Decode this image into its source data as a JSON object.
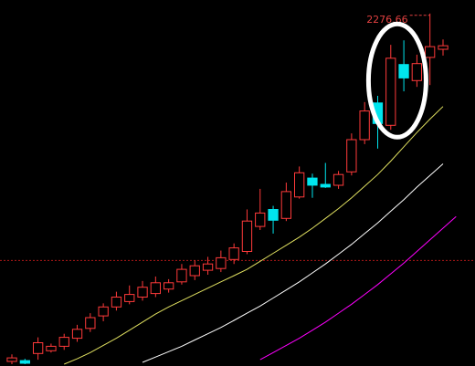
{
  "chart_data": {
    "type": "candlestick",
    "title": "",
    "xlabel": "",
    "ylabel": "",
    "ylim": [
      0,
      401
    ],
    "max_price_label": "2276.66",
    "reference_line": 116,
    "grid": false,
    "colors": {
      "background": "#000000",
      "up": "#ff3a3a",
      "down": "#00e5ee",
      "reference_line": "#b01818",
      "highlight_ellipse": "#ffffff"
    },
    "candles": [
      {
        "o": 3,
        "c": 7,
        "h": 11,
        "l": 0
      },
      {
        "o": 4,
        "c": 1,
        "h": 6,
        "l": 0
      },
      {
        "o": 12,
        "c": 24,
        "h": 30,
        "l": 5
      },
      {
        "o": 15,
        "c": 20,
        "h": 23,
        "l": 13
      },
      {
        "o": 20,
        "c": 30,
        "h": 34,
        "l": 16
      },
      {
        "o": 29,
        "c": 39,
        "h": 44,
        "l": 25
      },
      {
        "o": 40,
        "c": 52,
        "h": 57,
        "l": 36
      },
      {
        "o": 54,
        "c": 64,
        "h": 68,
        "l": 48
      },
      {
        "o": 64,
        "c": 75,
        "h": 81,
        "l": 60
      },
      {
        "o": 70,
        "c": 78,
        "h": 88,
        "l": 67
      },
      {
        "o": 75,
        "c": 86,
        "h": 93,
        "l": 71
      },
      {
        "o": 79,
        "c": 91,
        "h": 98,
        "l": 75
      },
      {
        "o": 84,
        "c": 91,
        "h": 95,
        "l": 80
      },
      {
        "o": 92,
        "c": 106,
        "h": 112,
        "l": 89
      },
      {
        "o": 99,
        "c": 110,
        "h": 116,
        "l": 94
      },
      {
        "o": 105,
        "c": 112,
        "h": 120,
        "l": 100
      },
      {
        "o": 107,
        "c": 119,
        "h": 127,
        "l": 103
      },
      {
        "o": 117,
        "c": 130,
        "h": 135,
        "l": 112
      },
      {
        "o": 126,
        "c": 160,
        "h": 173,
        "l": 123
      },
      {
        "o": 154,
        "c": 169,
        "h": 196,
        "l": 150
      },
      {
        "o": 173,
        "c": 161,
        "h": 177,
        "l": 146
      },
      {
        "o": 163,
        "c": 193,
        "h": 203,
        "l": 160
      },
      {
        "o": 187,
        "c": 214,
        "h": 221,
        "l": 185
      },
      {
        "o": 208,
        "c": 200,
        "h": 213,
        "l": 186
      },
      {
        "o": 201,
        "c": 198,
        "h": 225,
        "l": 197
      },
      {
        "o": 200,
        "c": 212,
        "h": 216,
        "l": 196
      },
      {
        "o": 215,
        "c": 251,
        "h": 258,
        "l": 211
      },
      {
        "o": 251,
        "c": 283,
        "h": 293,
        "l": 246
      },
      {
        "o": 292,
        "c": 269,
        "h": 300,
        "l": 241
      },
      {
        "o": 267,
        "c": 342,
        "h": 357,
        "l": 262
      },
      {
        "o": 335,
        "c": 320,
        "h": 362,
        "l": 305
      },
      {
        "o": 317,
        "c": 336,
        "h": 346,
        "l": 310
      },
      {
        "o": 343,
        "c": 355,
        "h": 392,
        "l": 312
      },
      {
        "o": 352,
        "c": 356,
        "h": 363,
        "l": 345
      }
    ],
    "moving_averages": [
      {
        "color": "#e0e060",
        "values": [
          null,
          null,
          null,
          null,
          0,
          6,
          13,
          21,
          29,
          38,
          47,
          56,
          64,
          71,
          78,
          85,
          92,
          99,
          106,
          115,
          124,
          133,
          142,
          152,
          163,
          174,
          186,
          199,
          212,
          227,
          243,
          259,
          274,
          288
        ]
      },
      {
        "color": "#ffffff",
        "values": [
          null,
          null,
          null,
          null,
          null,
          null,
          null,
          null,
          null,
          null,
          2,
          8,
          14,
          20,
          27,
          34,
          41,
          49,
          57,
          65,
          74,
          83,
          92,
          102,
          112,
          123,
          134,
          146,
          158,
          171,
          184,
          198,
          211,
          224
        ]
      },
      {
        "color": "#ff00ff",
        "values": [
          null,
          null,
          null,
          null,
          null,
          null,
          null,
          null,
          null,
          null,
          null,
          null,
          null,
          null,
          null,
          null,
          null,
          null,
          null,
          5,
          13,
          21,
          29,
          38,
          47,
          57,
          67,
          78,
          89,
          101,
          113,
          126,
          139,
          152,
          165
        ]
      },
      {
        "color": "#00ff00",
        "values": [
          null,
          null,
          null,
          null,
          null,
          null,
          null,
          null,
          null,
          null,
          null,
          null,
          null,
          null,
          null,
          null,
          null,
          null,
          null,
          null,
          null,
          null,
          null,
          null,
          null,
          null,
          null,
          null,
          null,
          null,
          null,
          null,
          null,
          null,
          null
        ]
      },
      {
        "color": "#909090",
        "values": [
          null,
          null,
          null,
          null,
          null,
          null,
          null,
          null,
          null,
          null,
          null,
          null,
          null,
          null,
          null,
          null,
          null,
          null,
          null,
          null,
          null,
          null,
          null,
          null,
          null,
          null,
          null,
          null,
          null,
          null,
          null,
          null,
          null,
          null,
          null
        ]
      }
    ]
  }
}
